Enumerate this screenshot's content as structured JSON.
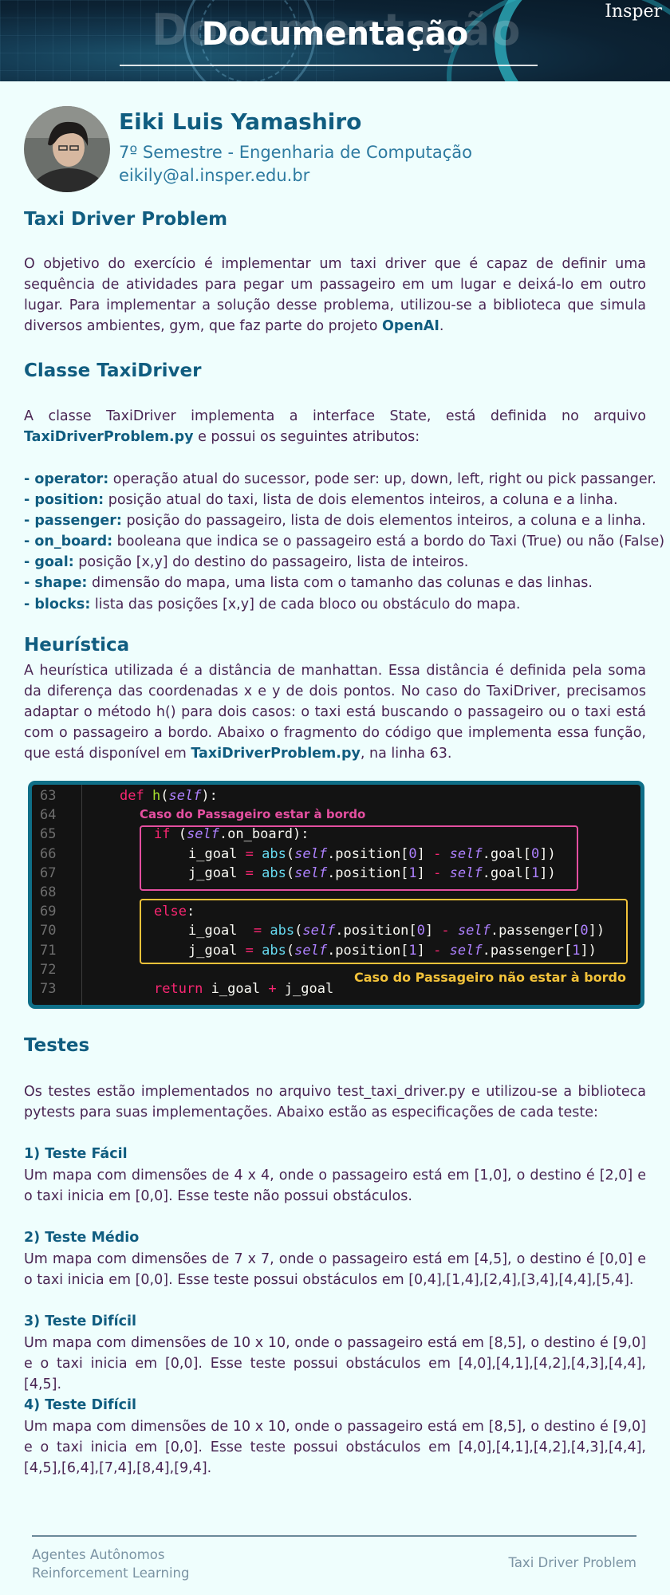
{
  "header": {
    "title": "Documentação",
    "ghost_title": "Documentação",
    "brand": "Insper"
  },
  "author": {
    "name": "Eiki Luis Yamashiro",
    "course": "7º Semestre - Engenharia de Computação",
    "email": "eikily@al.insper.edu.br"
  },
  "section1": {
    "heading": "Taxi Driver Problem",
    "para_before": "O objetivo do exercício é implementar um taxi driver que é capaz de definir uma sequência de atividades para pegar um passageiro em um lugar e deixá-lo em outro lugar. Para implementar a solução desse problema, utilizou-se a biblioteca que simula diversos ambientes, gym, que faz parte do projeto ",
    "para_strong": "OpenAI",
    "para_after": "."
  },
  "section2": {
    "heading": "Classe TaxiDriver",
    "para_before": "A classe TaxiDriver implementa a interface State, está definida no arquivo ",
    "para_strong": "TaxiDriverProblem.py",
    "para_after": " e possui os seguintes atributos:",
    "attributes": [
      {
        "key": "- operator:",
        "text": " operação atual do sucessor, pode ser: up, down, left, right ou pick passanger."
      },
      {
        "key": "- position:",
        "text": " posição atual do taxi, lista de dois elementos inteiros, a coluna e a linha."
      },
      {
        "key": "- passenger:",
        "text": " posição do passageiro, lista de dois elementos inteiros, a coluna e a linha."
      },
      {
        "key": "- on_board:",
        "text": " booleana que indica se o passageiro está a bordo do Taxi (True)  ou não (False)"
      },
      {
        "key": "- goal:",
        "text": " posição [x,y] do destino do passageiro, lista de inteiros."
      },
      {
        "key": "- shape:",
        "text": " dimensão do mapa, uma lista com o tamanho das colunas e das linhas."
      },
      {
        "key": "- blocks:",
        "text": " lista das posições [x,y] de cada bloco ou obstáculo do mapa."
      }
    ]
  },
  "section3": {
    "heading": "Heurística",
    "para_before": "A heurística utilizada é a distância de manhattan. Essa distância é definida pela soma da diferença das coordenadas x e y de dois pontos. No caso do TaxiDriver, precisamos adaptar o método h() para dois casos: o taxi está buscando o passageiro ou o taxi está com o passageiro a bordo. Abaixo o fragmento do código que implementa essa função, que está disponível em ",
    "para_strong": "TaxiDriverProblem.py",
    "para_after": ", na linha 63."
  },
  "code": {
    "annotation_pink": "Caso do Passageiro estar à bordo",
    "annotation_yellow": "Caso do Passageiro não estar à bordo",
    "lines": [
      {
        "n": "63",
        "indent": 0,
        "tokens": [
          [
            "kw",
            "def "
          ],
          [
            "fn",
            "h"
          ],
          [
            "",
            "("
          ],
          [
            "self",
            "self"
          ],
          [
            "",
            "):"
          ]
        ]
      },
      {
        "n": "64",
        "indent": 0,
        "tokens": []
      },
      {
        "n": "65",
        "indent": 1,
        "tokens": [
          [
            "kw",
            "if "
          ],
          [
            "",
            "("
          ],
          [
            "self",
            "self"
          ],
          [
            "",
            ".on_board):"
          ]
        ]
      },
      {
        "n": "66",
        "indent": 2,
        "tokens": [
          [
            "",
            "i_goal "
          ],
          [
            "op",
            "="
          ],
          [
            "bi",
            " abs"
          ],
          [
            "",
            "("
          ],
          [
            "self",
            "self"
          ],
          [
            "",
            ".position["
          ],
          [
            "num",
            "0"
          ],
          [
            "",
            "] "
          ],
          [
            "op",
            "-"
          ],
          [
            "",
            ""
          ],
          [
            "self",
            " self"
          ],
          [
            "",
            ".goal["
          ],
          [
            "num",
            "0"
          ],
          [
            "",
            "])"
          ]
        ]
      },
      {
        "n": "67",
        "indent": 2,
        "tokens": [
          [
            "",
            "j_goal "
          ],
          [
            "op",
            "="
          ],
          [
            "bi",
            " abs"
          ],
          [
            "",
            "("
          ],
          [
            "self",
            "self"
          ],
          [
            "",
            ".position["
          ],
          [
            "num",
            "1"
          ],
          [
            "",
            "] "
          ],
          [
            "op",
            "-"
          ],
          [
            "self",
            " self"
          ],
          [
            "",
            ".goal["
          ],
          [
            "num",
            "1"
          ],
          [
            "",
            "])"
          ]
        ]
      },
      {
        "n": "68",
        "indent": 0,
        "tokens": []
      },
      {
        "n": "69",
        "indent": 1,
        "tokens": [
          [
            "kw",
            "else"
          ],
          [
            "",
            ":"
          ]
        ]
      },
      {
        "n": "70",
        "indent": 2,
        "tokens": [
          [
            "",
            "i_goal  "
          ],
          [
            "op",
            "="
          ],
          [
            "bi",
            " abs"
          ],
          [
            "",
            "("
          ],
          [
            "self",
            "self"
          ],
          [
            "",
            ".position["
          ],
          [
            "num",
            "0"
          ],
          [
            "",
            "] "
          ],
          [
            "op",
            "-"
          ],
          [
            "self",
            " self"
          ],
          [
            "",
            ".passenger["
          ],
          [
            "num",
            "0"
          ],
          [
            "",
            "])"
          ]
        ]
      },
      {
        "n": "71",
        "indent": 2,
        "tokens": [
          [
            "",
            "j_goal "
          ],
          [
            "op",
            "="
          ],
          [
            "bi",
            " abs"
          ],
          [
            "",
            "("
          ],
          [
            "self",
            "self"
          ],
          [
            "",
            ".position["
          ],
          [
            "num",
            "1"
          ],
          [
            "",
            "] "
          ],
          [
            "op",
            "-"
          ],
          [
            "self",
            " self"
          ],
          [
            "",
            ".passenger["
          ],
          [
            "num",
            "1"
          ],
          [
            "",
            "])"
          ]
        ]
      },
      {
        "n": "72",
        "indent": 0,
        "tokens": []
      },
      {
        "n": "73",
        "indent": 1,
        "tokens": [
          [
            "kw",
            "return "
          ],
          [
            "",
            "i_goal "
          ],
          [
            "op",
            "+"
          ],
          [
            "",
            " j_goal"
          ]
        ]
      }
    ]
  },
  "section4": {
    "heading": "Testes",
    "intro": "Os testes estão implementados no arquivo test_taxi_driver.py e utilizou-se a biblioteca pytests para suas implementações. Abaixo estão as especificações de cada teste:",
    "tests": [
      {
        "title": "1) Teste Fácil",
        "text": "Um mapa com dimensões de 4 x 4, onde o passageiro está em [1,0], o destino é [2,0] e o taxi inicia em [0,0]. Esse teste não possui obstáculos."
      },
      {
        "title": "2) Teste Médio",
        "text": "Um mapa com dimensões de 7 x 7, onde o passageiro está em [4,5], o destino é [0,0] e o taxi inicia em [0,0]. Esse teste possui obstáculos em [0,4],[1,4],[2,4],[3,4],[4,4],[5,4]."
      },
      {
        "title": "3) Teste Difícil",
        "text": "Um mapa com dimensões de 10 x 10, onde o passageiro está em [8,5], o destino é [9,0] e o taxi inicia em [0,0]. Esse teste possui obstáculos em [4,0],[4,1],[4,2],[4,3],[4,4],[4,5]."
      },
      {
        "title": "4) Teste Difícil",
        "text": "Um mapa com dimensões de 10 x 10, onde o passageiro está em [8,5], o destino é [9,0] e o taxi inicia em [0,0]. Esse teste possui obstáculos em [4,0],[4,1],[4,2],[4,3],[4,4],[4,5],[6,4],[7,4],[8,4],[9,4]."
      }
    ]
  },
  "footer": {
    "left_line1": "Agentes Autônomos",
    "left_line2": "Reinforcement Learning",
    "right": "Taxi Driver Problem"
  }
}
